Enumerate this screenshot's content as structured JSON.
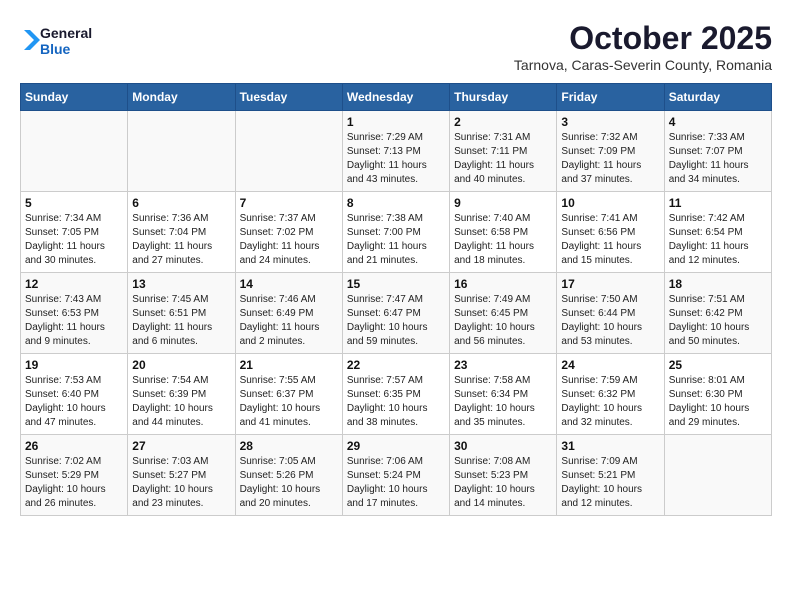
{
  "header": {
    "logo_general": "General",
    "logo_blue": "Blue",
    "month_title": "October 2025",
    "subtitle": "Tarnova, Caras-Severin County, Romania"
  },
  "calendar": {
    "days_of_week": [
      "Sunday",
      "Monday",
      "Tuesday",
      "Wednesday",
      "Thursday",
      "Friday",
      "Saturday"
    ],
    "weeks": [
      [
        {
          "day": "",
          "info": ""
        },
        {
          "day": "",
          "info": ""
        },
        {
          "day": "",
          "info": ""
        },
        {
          "day": "1",
          "info": "Sunrise: 7:29 AM\nSunset: 7:13 PM\nDaylight: 11 hours\nand 43 minutes."
        },
        {
          "day": "2",
          "info": "Sunrise: 7:31 AM\nSunset: 7:11 PM\nDaylight: 11 hours\nand 40 minutes."
        },
        {
          "day": "3",
          "info": "Sunrise: 7:32 AM\nSunset: 7:09 PM\nDaylight: 11 hours\nand 37 minutes."
        },
        {
          "day": "4",
          "info": "Sunrise: 7:33 AM\nSunset: 7:07 PM\nDaylight: 11 hours\nand 34 minutes."
        }
      ],
      [
        {
          "day": "5",
          "info": "Sunrise: 7:34 AM\nSunset: 7:05 PM\nDaylight: 11 hours\nand 30 minutes."
        },
        {
          "day": "6",
          "info": "Sunrise: 7:36 AM\nSunset: 7:04 PM\nDaylight: 11 hours\nand 27 minutes."
        },
        {
          "day": "7",
          "info": "Sunrise: 7:37 AM\nSunset: 7:02 PM\nDaylight: 11 hours\nand 24 minutes."
        },
        {
          "day": "8",
          "info": "Sunrise: 7:38 AM\nSunset: 7:00 PM\nDaylight: 11 hours\nand 21 minutes."
        },
        {
          "day": "9",
          "info": "Sunrise: 7:40 AM\nSunset: 6:58 PM\nDaylight: 11 hours\nand 18 minutes."
        },
        {
          "day": "10",
          "info": "Sunrise: 7:41 AM\nSunset: 6:56 PM\nDaylight: 11 hours\nand 15 minutes."
        },
        {
          "day": "11",
          "info": "Sunrise: 7:42 AM\nSunset: 6:54 PM\nDaylight: 11 hours\nand 12 minutes."
        }
      ],
      [
        {
          "day": "12",
          "info": "Sunrise: 7:43 AM\nSunset: 6:53 PM\nDaylight: 11 hours\nand 9 minutes."
        },
        {
          "day": "13",
          "info": "Sunrise: 7:45 AM\nSunset: 6:51 PM\nDaylight: 11 hours\nand 6 minutes."
        },
        {
          "day": "14",
          "info": "Sunrise: 7:46 AM\nSunset: 6:49 PM\nDaylight: 11 hours\nand 2 minutes."
        },
        {
          "day": "15",
          "info": "Sunrise: 7:47 AM\nSunset: 6:47 PM\nDaylight: 10 hours\nand 59 minutes."
        },
        {
          "day": "16",
          "info": "Sunrise: 7:49 AM\nSunset: 6:45 PM\nDaylight: 10 hours\nand 56 minutes."
        },
        {
          "day": "17",
          "info": "Sunrise: 7:50 AM\nSunset: 6:44 PM\nDaylight: 10 hours\nand 53 minutes."
        },
        {
          "day": "18",
          "info": "Sunrise: 7:51 AM\nSunset: 6:42 PM\nDaylight: 10 hours\nand 50 minutes."
        }
      ],
      [
        {
          "day": "19",
          "info": "Sunrise: 7:53 AM\nSunset: 6:40 PM\nDaylight: 10 hours\nand 47 minutes."
        },
        {
          "day": "20",
          "info": "Sunrise: 7:54 AM\nSunset: 6:39 PM\nDaylight: 10 hours\nand 44 minutes."
        },
        {
          "day": "21",
          "info": "Sunrise: 7:55 AM\nSunset: 6:37 PM\nDaylight: 10 hours\nand 41 minutes."
        },
        {
          "day": "22",
          "info": "Sunrise: 7:57 AM\nSunset: 6:35 PM\nDaylight: 10 hours\nand 38 minutes."
        },
        {
          "day": "23",
          "info": "Sunrise: 7:58 AM\nSunset: 6:34 PM\nDaylight: 10 hours\nand 35 minutes."
        },
        {
          "day": "24",
          "info": "Sunrise: 7:59 AM\nSunset: 6:32 PM\nDaylight: 10 hours\nand 32 minutes."
        },
        {
          "day": "25",
          "info": "Sunrise: 8:01 AM\nSunset: 6:30 PM\nDaylight: 10 hours\nand 29 minutes."
        }
      ],
      [
        {
          "day": "26",
          "info": "Sunrise: 7:02 AM\nSunset: 5:29 PM\nDaylight: 10 hours\nand 26 minutes."
        },
        {
          "day": "27",
          "info": "Sunrise: 7:03 AM\nSunset: 5:27 PM\nDaylight: 10 hours\nand 23 minutes."
        },
        {
          "day": "28",
          "info": "Sunrise: 7:05 AM\nSunset: 5:26 PM\nDaylight: 10 hours\nand 20 minutes."
        },
        {
          "day": "29",
          "info": "Sunrise: 7:06 AM\nSunset: 5:24 PM\nDaylight: 10 hours\nand 17 minutes."
        },
        {
          "day": "30",
          "info": "Sunrise: 7:08 AM\nSunset: 5:23 PM\nDaylight: 10 hours\nand 14 minutes."
        },
        {
          "day": "31",
          "info": "Sunrise: 7:09 AM\nSunset: 5:21 PM\nDaylight: 10 hours\nand 12 minutes."
        },
        {
          "day": "",
          "info": ""
        }
      ]
    ]
  }
}
